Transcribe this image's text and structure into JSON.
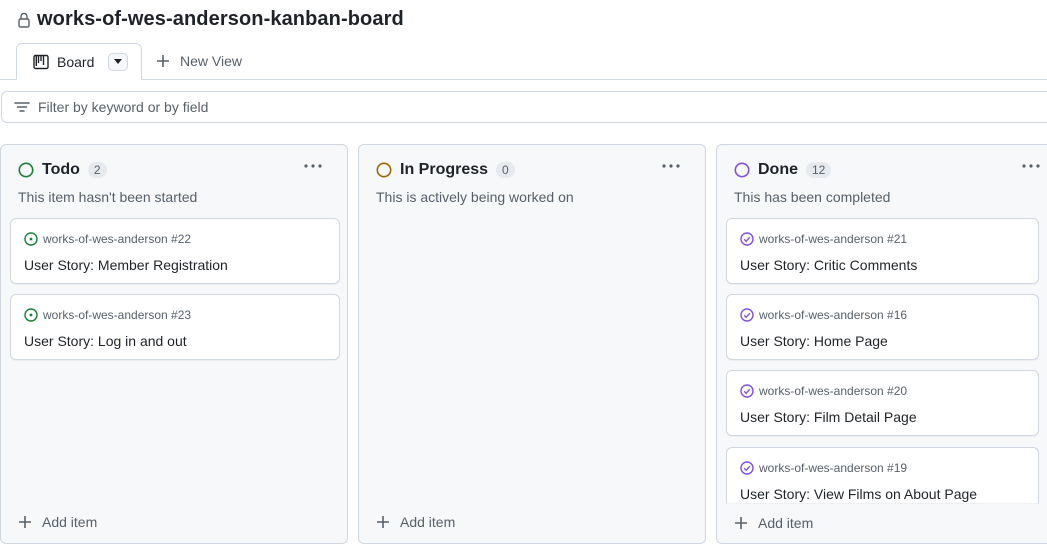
{
  "project": {
    "title": "works-of-wes-anderson-kanban-board"
  },
  "tabs": {
    "board_label": "Board",
    "new_view_label": "New View"
  },
  "filter": {
    "placeholder": "Filter by keyword or by field"
  },
  "colors": {
    "todo": "#1a7f37",
    "in_progress": "#9a6700",
    "done": "#8250df"
  },
  "columns": [
    {
      "title": "Todo",
      "count": "2",
      "description": "This item hasn't been started",
      "add_label": "Add item",
      "cards": [
        {
          "repo": "works-of-wes-anderson #22",
          "title": "User Story: Member Registration"
        },
        {
          "repo": "works-of-wes-anderson #23",
          "title": "User Story: Log in and out"
        }
      ]
    },
    {
      "title": "In Progress",
      "count": "0",
      "description": "This is actively being worked on",
      "add_label": "Add item",
      "cards": []
    },
    {
      "title": "Done",
      "count": "12",
      "description": "This has been completed",
      "add_label": "Add item",
      "cards": [
        {
          "repo": "works-of-wes-anderson #21",
          "title": "User Story: Critic Comments"
        },
        {
          "repo": "works-of-wes-anderson #16",
          "title": "User Story: Home Page"
        },
        {
          "repo": "works-of-wes-anderson #20",
          "title": "User Story: Film Detail Page"
        },
        {
          "repo": "works-of-wes-anderson #19",
          "title": "User Story: View Films on About Page"
        }
      ]
    }
  ]
}
